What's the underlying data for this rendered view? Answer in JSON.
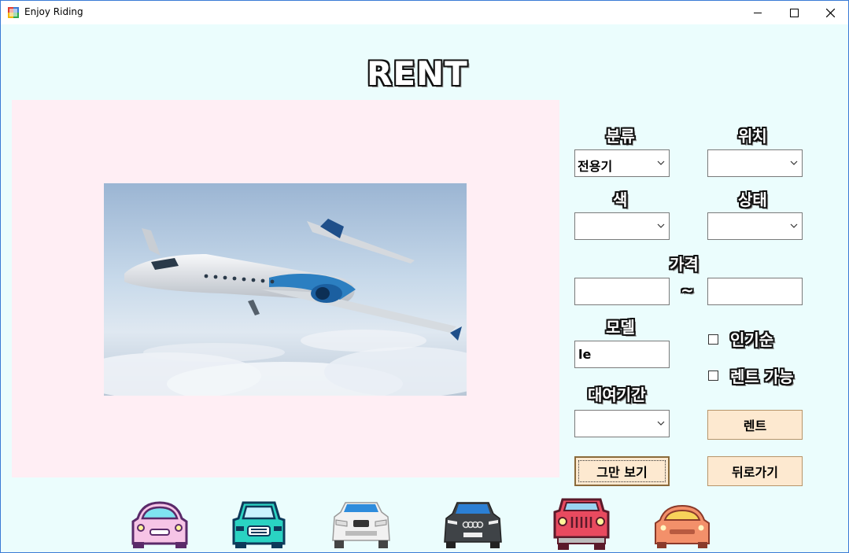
{
  "window": {
    "title": "Enjoy Riding"
  },
  "heading": {
    "title": "RENT"
  },
  "filters": {
    "category": {
      "label": "분류",
      "value": "전용기"
    },
    "location": {
      "label": "위치",
      "value": ""
    },
    "color": {
      "label": "색",
      "value": ""
    },
    "status": {
      "label": "상태",
      "value": ""
    },
    "price": {
      "label": "가격",
      "separator": "~",
      "min": "",
      "max": ""
    },
    "model": {
      "label": "모델",
      "value": "le"
    },
    "popular": {
      "label": "인기순",
      "checked": false
    },
    "rentable": {
      "label": "렌트 가능",
      "checked": false
    },
    "period": {
      "label": "대여기간",
      "value": ""
    }
  },
  "buttons": {
    "rent": "렌트",
    "stop": "그만 보기",
    "back": "뒤로가기"
  },
  "icons": [
    "app-icon",
    "minimize-icon",
    "maximize-icon",
    "close-icon",
    "car-pink-icon",
    "car-teal-icon",
    "car-white-suv-icon",
    "car-dark-sedan-icon",
    "car-red-jeep-icon",
    "car-orange-icon"
  ]
}
